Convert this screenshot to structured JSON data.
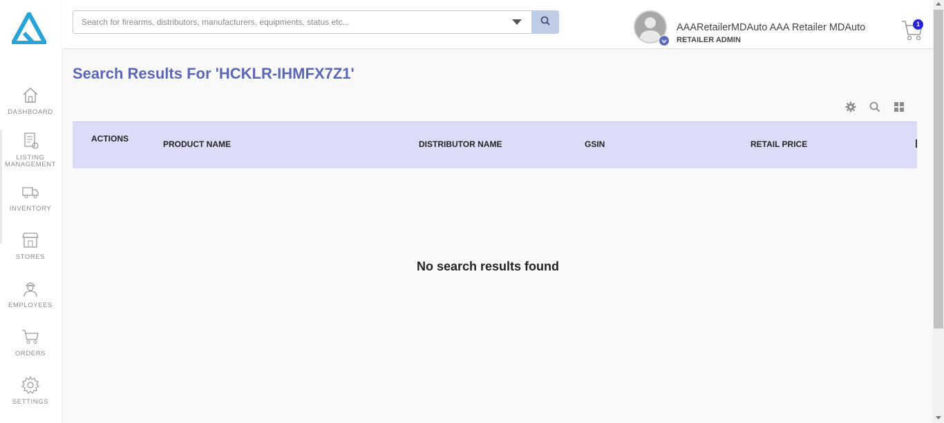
{
  "search": {
    "placeholder": "Search for firearms, distributors, manufacturers, equipments, status etc..."
  },
  "user": {
    "name": "AAARetailerMDAuto AAA Retailer MDAuto",
    "role": "RETAILER ADMIN"
  },
  "cart": {
    "count": "1"
  },
  "sidebar": {
    "items": [
      {
        "label": "DASHBOARD",
        "icon": "home-icon"
      },
      {
        "label_line1": "LISTING",
        "label_line2": "MANAGEMENT",
        "icon": "listing-icon"
      },
      {
        "label": "INVENTORY",
        "icon": "truck-icon"
      },
      {
        "label": "STORES",
        "icon": "store-icon"
      },
      {
        "label": "EMPLOYEES",
        "icon": "employee-icon"
      },
      {
        "label": "ORDERS",
        "icon": "cart-icon"
      },
      {
        "label": "SETTINGS",
        "icon": "gear-icon"
      }
    ]
  },
  "main": {
    "title": "Search Results For 'HCKLR-IHMFX7Z1'",
    "table": {
      "columns": [
        "ACTIONS",
        "PRODUCT NAME",
        "DISTRIBUTOR NAME",
        "GSIN",
        "RETAIL PRICE"
      ]
    },
    "empty_message": "No search results found"
  },
  "colors": {
    "title": "#5b67b5",
    "table_header_bg": "#dcdcf8",
    "search_button_bg": "#bfcde6",
    "cart_badge": "#2424d6",
    "logo": "#29a3d8"
  }
}
